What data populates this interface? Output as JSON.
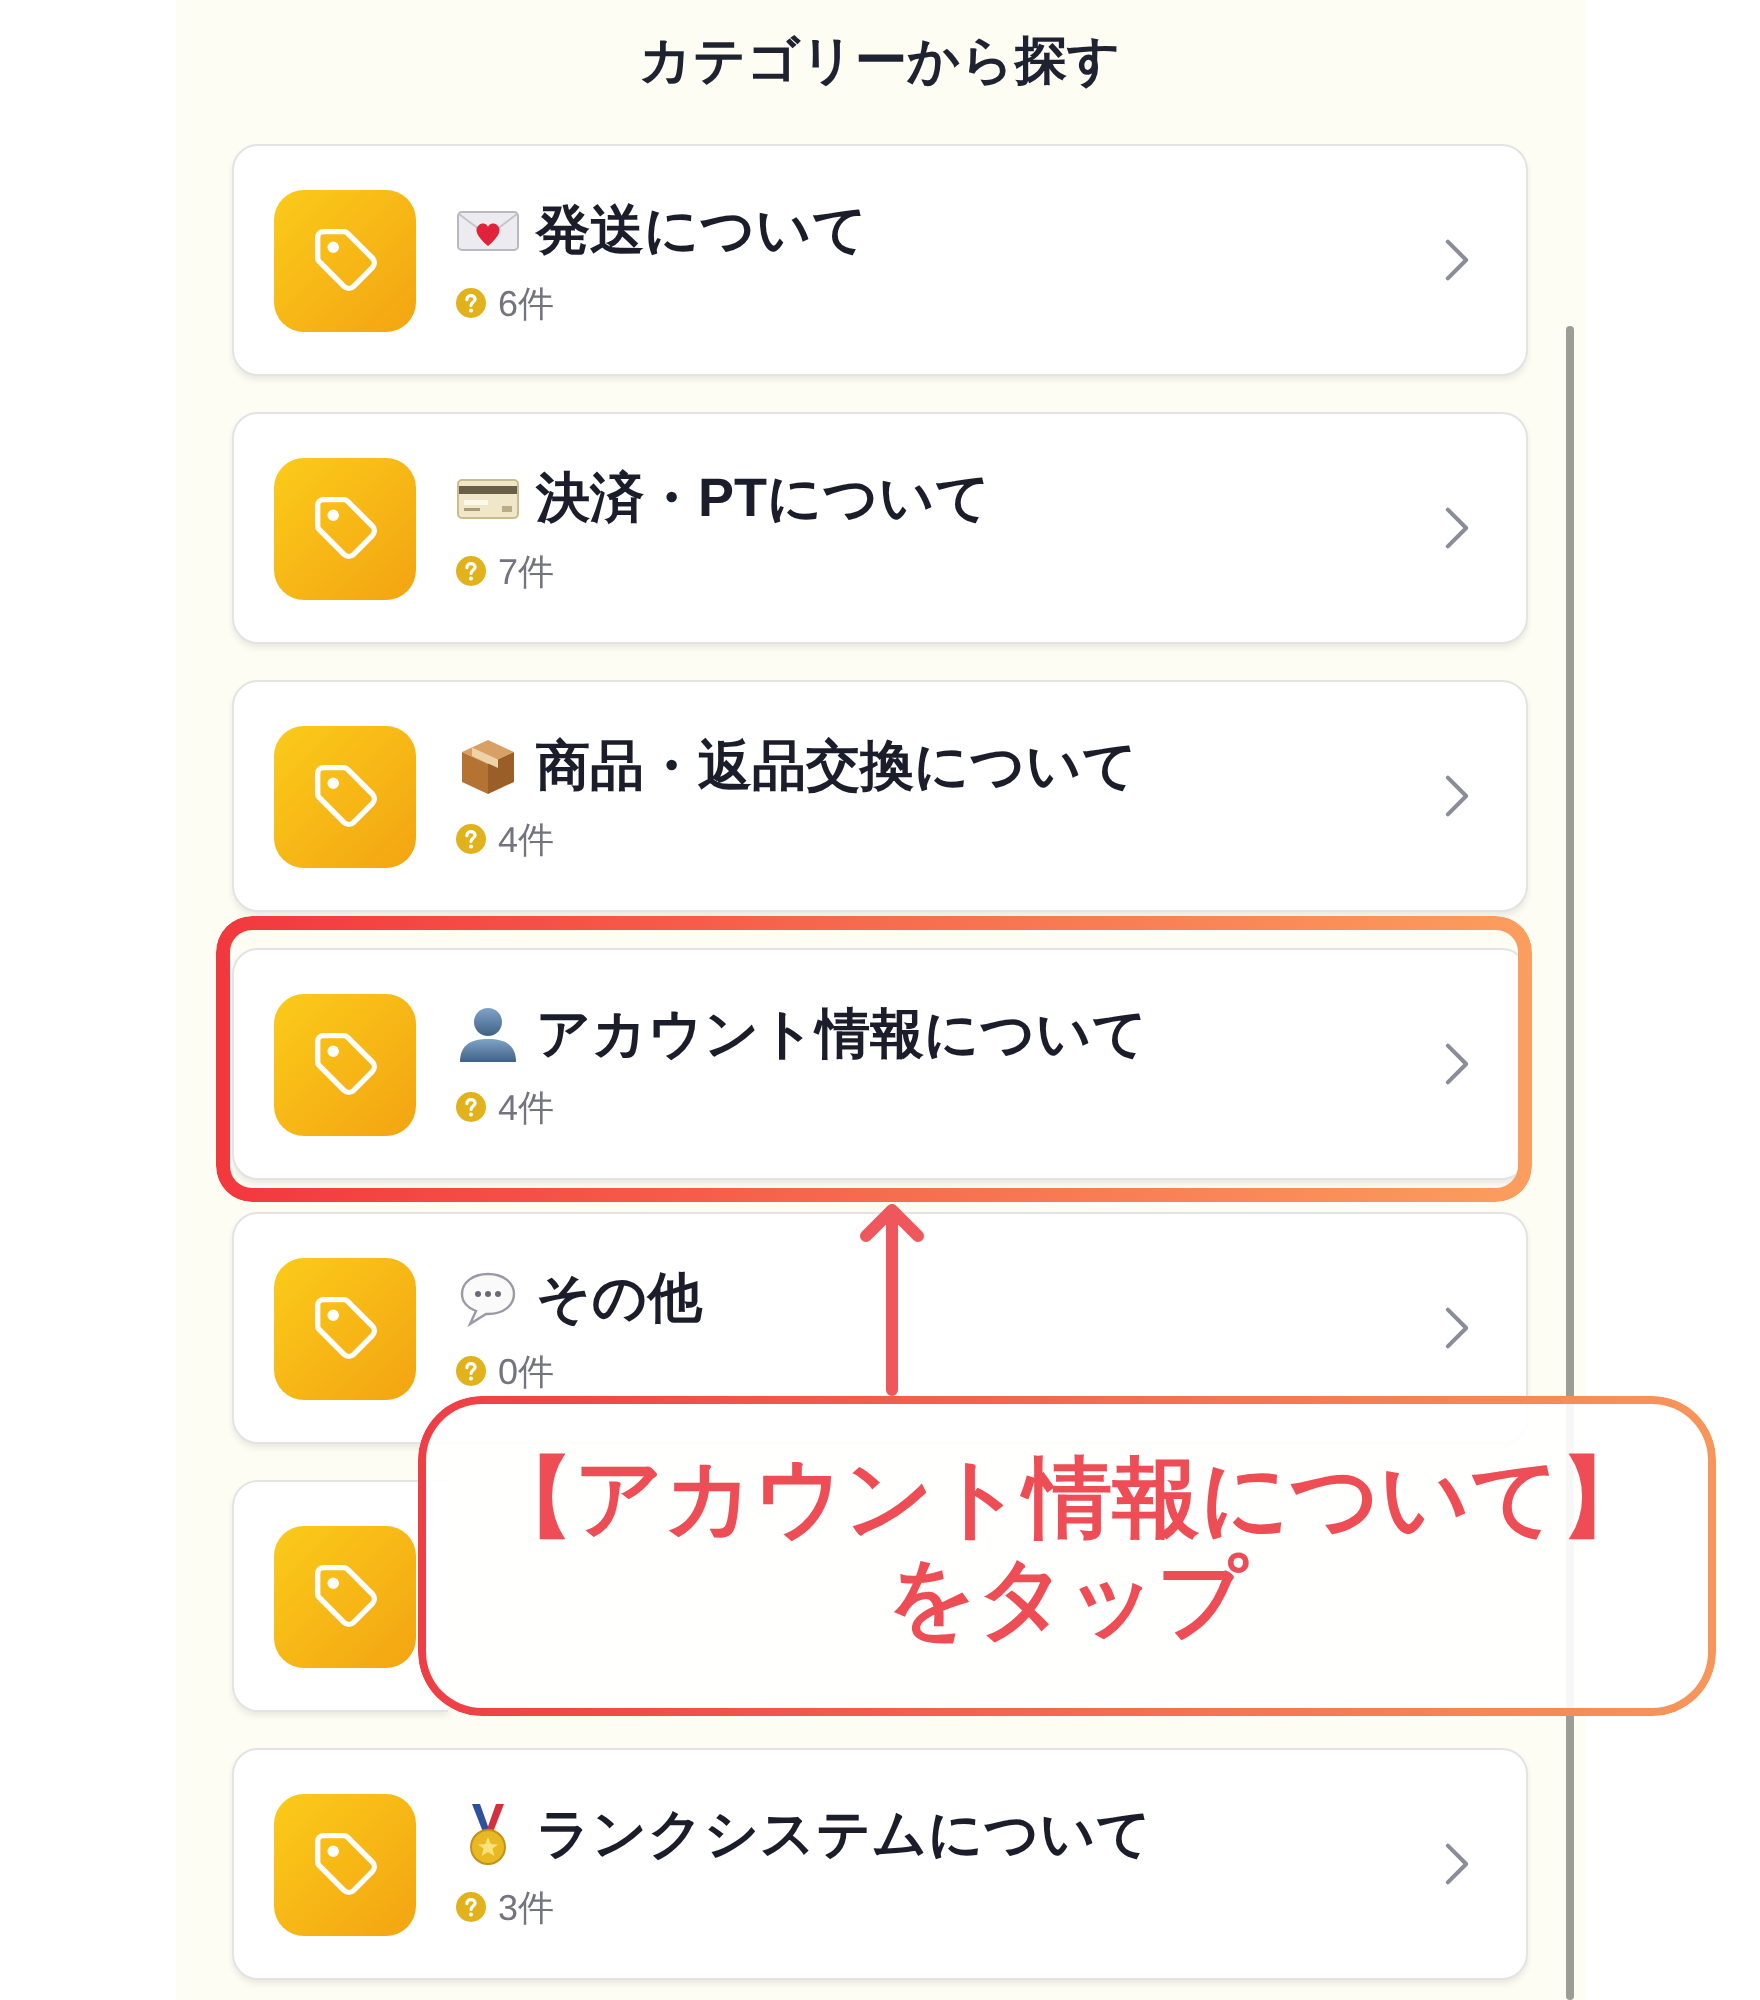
{
  "header": {
    "title": "カテゴリーから探す"
  },
  "categories": [
    {
      "kind": "mail",
      "title": "発送について",
      "count": "6件",
      "highlighted": false
    },
    {
      "kind": "card",
      "title": "決済・PTについて",
      "count": "7件",
      "highlighted": false
    },
    {
      "kind": "box",
      "title": "商品・返品交換について",
      "count": "4件",
      "highlighted": false
    },
    {
      "kind": "account",
      "title": "アカウント情報について",
      "count": "4件",
      "highlighted": true
    },
    {
      "kind": "chat",
      "title": "その他",
      "count": "0件",
      "highlighted": false
    },
    {
      "highlighted": false
    },
    {
      "kind": "medal",
      "title": "ランクシステムについて",
      "count": "3件",
      "highlighted": false
    }
  ],
  "annotation": {
    "callout": "【アカウント情報について】をタップ"
  }
}
